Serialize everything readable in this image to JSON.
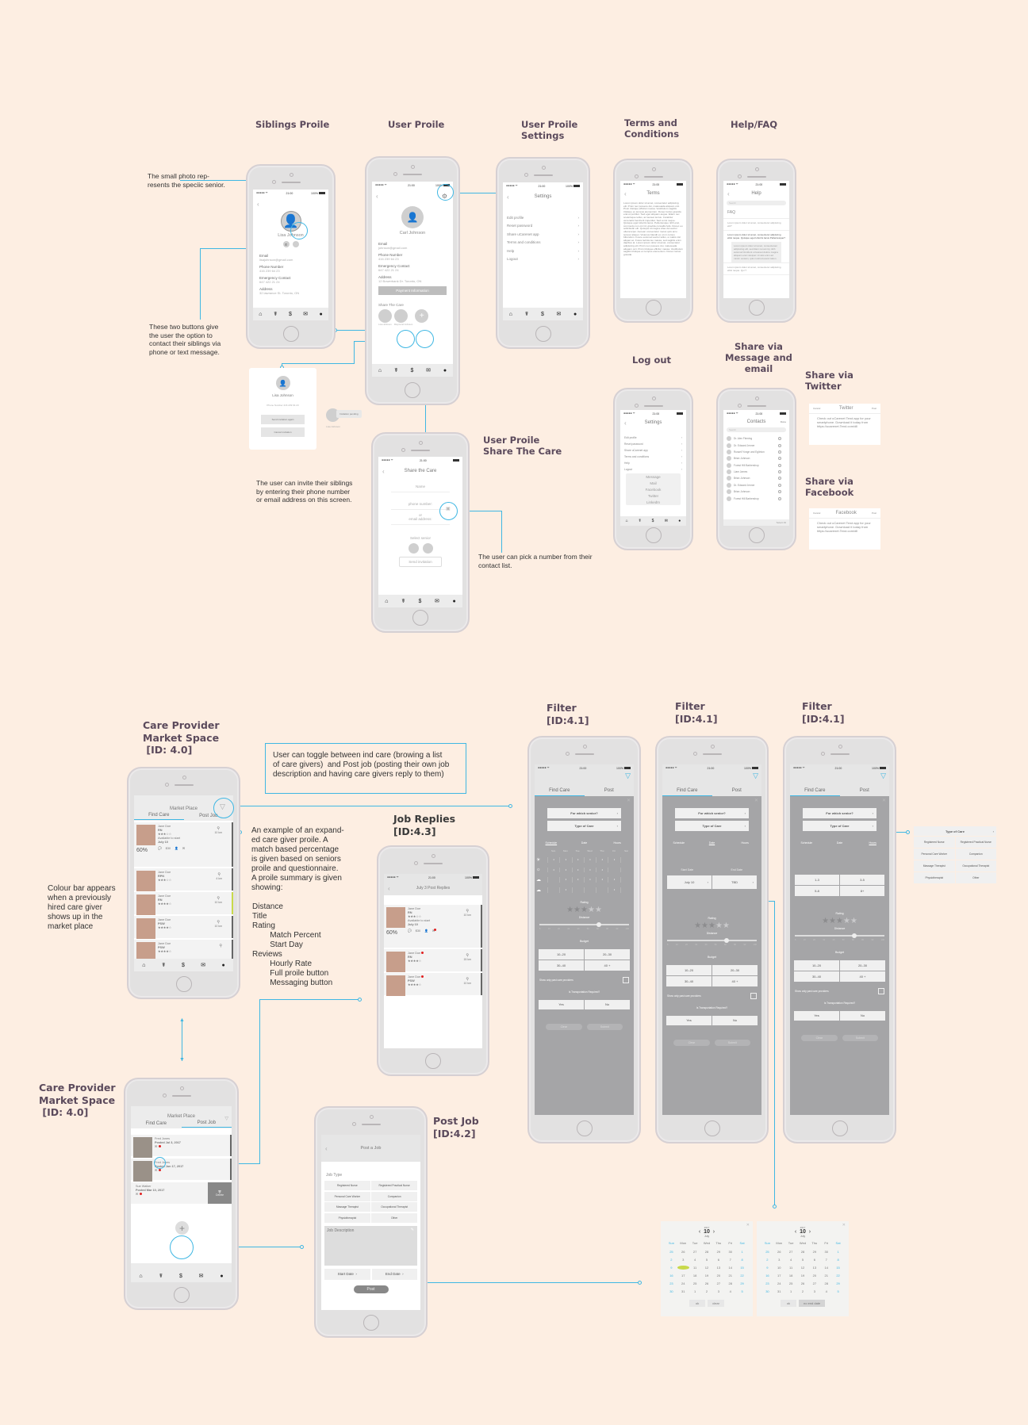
{
  "titles": {
    "siblings_profile": "Siblings Proile",
    "user_profile": "User Proile",
    "user_profile_settings": "User Proile\nSettings",
    "terms": "Terms and\nConditions",
    "help_faq": "Help/FAQ",
    "log_out": "Log out",
    "share_message_email": "Share via\nMessage and\nemail",
    "share_twitter": "Share via\nTwitter",
    "share_facebook": "Share via\nFacebook",
    "user_profile_share": "User Proile\nShare The Care",
    "market_space_1": "Care Provider\nMarket Space\n [ID: 4.0]",
    "market_space_2": "Care Provider\nMarket Space\n [ID: 4.0]",
    "job_replies": "Job Replies\n[ID:4.3]",
    "post_job": "Post Job\n[ID:4.2]",
    "filter": "Filter\n[ID:4.1]"
  },
  "notes": {
    "small_photo": "The small photo rep-\nresents the speciic senior.",
    "two_buttons": "These two buttons give\nthe user the option to\ncontact their siblings via\nphone or text message.",
    "invite_siblings": "The user can invite their siblings\nby entering their phone number\nor email address on this screen.",
    "pick_contact": "The user can pick a number from their\ncontact list.",
    "toggle": "User can toggle between ind care (browing a list\nof care givers)  and Post job (posting their own job\ndescription and having care givers reply to them)",
    "expanded_profile": "An example of an expand-\ned care giver proile. A\nmatch based percentage\nis given based on seniors\nproile and questionnaire.\nA proile summary is given\nshowing:",
    "profile_fields": [
      "Distance",
      "Title",
      "Rating",
      "        Match Percent",
      "        Start Day",
      "Reviews",
      "        Hourly Rate",
      "        Full proile button",
      "        Messaging button"
    ],
    "colour_bar": "Colour bar appears\nwhen a previously\nhired care giver\nshows up in the\nmarket place"
  },
  "status_bar": {
    "carrier": "●●●●● ᯤ",
    "time": "21:00",
    "battery": "100%"
  },
  "tab_icons": [
    "home-icon",
    "caregiver-icon",
    "dollar-icon",
    "mail-icon",
    "person-icon"
  ],
  "siblings_profile": {
    "name": "Lisa Johnson",
    "fields": [
      {
        "label": "Email",
        "value": "lisajohnson@gmail.com"
      },
      {
        "label": "Phone Number",
        "value": "416 239 64 23"
      },
      {
        "label": "Emergency Contact",
        "value": "647 422 21 24"
      },
      {
        "label": "Address",
        "value": "32 lawrance St. Toronto, ON"
      }
    ]
  },
  "user_profile": {
    "name": "Carl Johnson",
    "fields": [
      {
        "label": "Email",
        "value": "johnson@gmail.com"
      },
      {
        "label": "Phone Number",
        "value": "416 239 64 23"
      },
      {
        "label": "Emergency Contact",
        "value": "647 422 21 24"
      },
      {
        "label": "Address",
        "value": "12 Bowerbank Dr. Toronto, ON"
      }
    ],
    "payment_button": "Payment Information",
    "share_label": "Share The Care",
    "siblings": [
      "Lisa Johnson",
      "Raymond Johnson"
    ]
  },
  "invite_card": {
    "name": "Lisa Johnson",
    "phone_label": "Phone Number",
    "phone": "416 239 64 23",
    "resend": "Send invitation again",
    "cancel": "Cancel invitation",
    "pending": "Invitation pending",
    "pending_name": "Lisa Johnson"
  },
  "settings": {
    "title": "Settings",
    "items": [
      "Edit profile",
      "Reset password",
      "Share uCarenet app",
      "Terms and conditions",
      "Help",
      "Logout"
    ]
  },
  "terms": {
    "title": "Terms",
    "body": "Lorem ipsum dolor sit amet, consectetur adipiscing elit. Proin nec posuere dui, malesuada aliquam orci. Proin tristique efficitur massa. Vestibulum sagittis tristique ex tempus elementum. Donec luctus gravida erat et porttitor. Sed eget aliquam augue. Etiam nec scelerisque tellus, ac laoreet lectus. Curabitur venenatis hendrerit imperdiet. Sed a nisi neque. Quisque eget lobortis lacus. Pellentesque nibh erat, commodo non orci id, gravida convallis felis. Donec eu sollicitudin elit. Quisque id magna vitae dui auctor ullamcorper. Aenean consectetur metus quis arcu tempor aliquet. Vivamus blandit ex ut mi cursus bibendum. Fusce euismod auctor tellus, a mattis nisl aliquet ac. Fusce lacinia leo massa, sed sagittis enim dapibus at. Lorem ipsum dolor sit amet, consectetur adipiscing elit. Proin nec posuere dui, malesuada aliquam orci. Proin tristique efficitur massa. Vestibulum sagittis tristique ex tempus elementum. Donec luctus gravida"
  },
  "help": {
    "title": "Help",
    "search_placeholder": "Search",
    "faq": "FAQ",
    "q1": "Lorem ipsum dolor sit amet, consectetur adipiscing elit?",
    "q2": "Lorem ipsum dolor sit amet, consectetur adipiscing elitsi neque. Quisque eget lobortis lacus Pellentesque?",
    "a2": "Lorem ipsum dolor sit amet, consectetuer adipiscing elit, sed diam nonummy nibh euismod tincidunt ut laoreet dolore magna aliquam erat volutpat. Ut wisi enim ad minim veniam, quis nostrud exerci tation",
    "q3": "Lorem ipsum dolor sit amet, consectetur adipiscing elitsi neque. Qui ?"
  },
  "logout": {
    "title": "Settings",
    "share_options": [
      "Message",
      "Mail",
      "Facebook",
      "Twitter",
      "LinkedIn"
    ],
    "cancel": "Cancel"
  },
  "contacts": {
    "title": "Contacts",
    "done": "Done",
    "search_placeholder": "Search",
    "list": [
      "Dr. Alex Fleming",
      "Dr. Edward Jenner",
      "Russell Yonge and Eglinton",
      "Brian Johnson",
      "Forest Hill Barbershop",
      "Liam James",
      "Brian Johnson",
      "Dr. Edward Jenner",
      "Brian Johnson",
      "Forest Hill Barbershop"
    ],
    "select_all": "Select All",
    "alphabet": "ABCDEFGHIJKLMNOPQRSTUVWXYZ#"
  },
  "twitter_share": {
    "cancel": "Cancel",
    "title": "Twitter",
    "post": "Post",
    "body": "Check out  uCarenet Tend app for your smartphone. Download it today from https://ucarenet.Tend.com/dll"
  },
  "facebook_share": {
    "cancel": "Cancel",
    "title": "Facebook",
    "post": "Post",
    "body": "Check out  uCarenet Tend app for your smartphone. Download it today from https://ucarenet.Tend.com/dll"
  },
  "share_care": {
    "title": "Share the Care",
    "name_placeholder": "Name",
    "phone_placeholder": "phone number:",
    "or": "or",
    "email_placeholder": "email address:",
    "select_senior": "Select senior",
    "send": "Send invitation"
  },
  "marketplace": {
    "title": "Market Place",
    "tab_find": "Find Care",
    "tab_post": "Post Job",
    "expanded": {
      "name": "Jane Doe",
      "title": "RN",
      "rating": 3,
      "match": "60%",
      "available_label": "Available to start",
      "start": "July 10",
      "reviews": "4",
      "rate": "$30",
      "distance": "10 km",
      "action_labels": [
        "Reviews",
        "Hourly Rate",
        "Full Profile",
        "Message"
      ]
    },
    "caregivers": [
      {
        "name": "Jane Doe",
        "title": "RPN",
        "rating": 3,
        "distance": "4 km",
        "bar": "#666666"
      },
      {
        "name": "Jane Doe",
        "title": "RN",
        "rating": 4,
        "distance": "10 km",
        "bar": "#c8d94a"
      },
      {
        "name": "Jane Doe",
        "title": "PSW",
        "rating": 4,
        "distance": "10 km",
        "bar": "#666666"
      },
      {
        "name": "Jane Doe",
        "title": "PSW",
        "rating": 4,
        "distance": "",
        "bar": "#666666"
      }
    ]
  },
  "post_list": {
    "jobs": [
      {
        "name": "Fred Jones",
        "posted": "Posted Jul 3, 2017"
      },
      {
        "name": "Fred Jones",
        "posted": "Posted Jun 17, 2017"
      },
      {
        "name": "Sue Walker",
        "posted": "Posted Mar 10, 2017"
      }
    ],
    "delete": "Delete"
  },
  "job_replies": {
    "title": "July 3 Post Replies",
    "expanded": {
      "name": "Jane Doe",
      "title": "RN",
      "match": "60%",
      "available_label": "Available to start",
      "start": "July 10",
      "rate": "$30",
      "distance": "10 km"
    },
    "replies": [
      {
        "name": "Jane Doe",
        "title": "RN",
        "distance": "15 km"
      },
      {
        "name": "Jane Doe",
        "title": "PSW",
        "distance": "10 km"
      }
    ]
  },
  "post_job": {
    "title": "Post a Job",
    "job_type_label": "Job Type",
    "job_types": [
      "Registered Nurse",
      "Registered Practical Nurse",
      "Personal Care Worker",
      "Companion",
      "Massage Therapist",
      "Occupational Therapist",
      "Physiotherapist",
      "Other"
    ],
    "description_label": "Job Description",
    "start_date": "Start Date",
    "end_date": "End Date",
    "post": "Post"
  },
  "filter": {
    "tab_find": "Find Care",
    "tab_post": "Post",
    "senior": "For which senior?",
    "care_type": "Type of Care",
    "subtabs": [
      "Schedule",
      "Date",
      "Hours"
    ],
    "days": [
      "Sun",
      "Mon",
      "Tue",
      "Wed",
      "Thu",
      "Fri",
      "Sat"
    ],
    "start_label": "Start Date",
    "end_label": "End Date",
    "start_value": "July 10",
    "end_value": "TBD",
    "hours": [
      "1-3",
      "3-5",
      "5-8",
      "8+"
    ],
    "rating_label": "Rating",
    "rating_value": 3,
    "distance_label": "Distance",
    "distance_ticks": [
      "5",
      "10",
      "20",
      "30",
      "40",
      "50",
      "60",
      "80",
      "90",
      "100"
    ],
    "distance_value": 60,
    "budget_label": "Budget",
    "budget": [
      "10–20",
      "20–30",
      "30–40",
      "40 +"
    ],
    "past_providers": "Show only past care providers",
    "transport": "Is Transportation Required?",
    "yes": "Yes",
    "no": "No",
    "clear": "Clear",
    "submit": "Submit",
    "care_types_popup": [
      "Registered Nurse",
      "Registered Practical Nurse",
      "Personal Care Worker",
      "Companion",
      "Massage Therapist",
      "Occupational Therapist",
      "Physiotherapist",
      "Other"
    ]
  },
  "calendars": [
    {
      "year": "2017",
      "day": "10",
      "month": "July",
      "days": [
        "Sun",
        "Mon",
        "Tue",
        "Wed",
        "Thu",
        "Fri",
        "Sat"
      ],
      "dates": [
        "25",
        "26",
        "27",
        "28",
        "29",
        "30",
        "1",
        "2",
        "3",
        "4",
        "5",
        "6",
        "7",
        "8",
        "9",
        "10",
        "11",
        "12",
        "13",
        "14",
        "15",
        "16",
        "17",
        "18",
        "19",
        "20",
        "21",
        "22",
        "23",
        "24",
        "25",
        "26",
        "27",
        "28",
        "29",
        "30",
        "31",
        "1",
        "2",
        "3",
        "4",
        "5"
      ],
      "selected": "10",
      "ok": "ok",
      "alt": "clear"
    },
    {
      "year": "2017",
      "day": "10",
      "month": "July",
      "days": [
        "Sun",
        "Mon",
        "Tue",
        "Wed",
        "Thu",
        "Fri",
        "Sat"
      ],
      "dates": [
        "25",
        "26",
        "27",
        "28",
        "29",
        "30",
        "1",
        "2",
        "3",
        "4",
        "5",
        "6",
        "7",
        "8",
        "9",
        "10",
        "11",
        "12",
        "13",
        "14",
        "15",
        "16",
        "17",
        "18",
        "19",
        "20",
        "21",
        "22",
        "23",
        "24",
        "25",
        "26",
        "27",
        "28",
        "29",
        "30",
        "31",
        "1",
        "2",
        "3",
        "4",
        "5"
      ],
      "selected": "",
      "ok": "ok",
      "alt": "no end date"
    }
  ],
  "colors": {
    "accent": "#3fb7e3",
    "title": "#5b4a5c",
    "background": "#fdeee2",
    "filter_overlay": "#a5a5a7",
    "hired_bar": "#c8d94a",
    "notification": "#e02020"
  }
}
